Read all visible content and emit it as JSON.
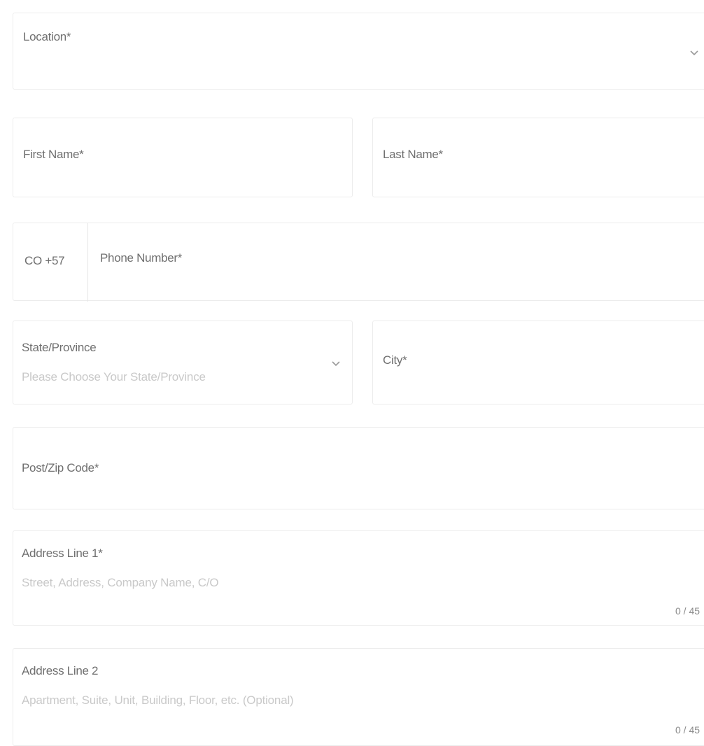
{
  "form": {
    "location": {
      "label": "Location*",
      "icon": "chevron-down-icon"
    },
    "first_name": {
      "label": "First Name*"
    },
    "last_name": {
      "label": "Last Name*"
    },
    "phone": {
      "country_code": "CO +57",
      "label": "Phone Number*"
    },
    "state": {
      "label": "State/Province",
      "placeholder": "Please Choose Your State/Province",
      "icon": "chevron-down-icon"
    },
    "city": {
      "label": "City*"
    },
    "postcode": {
      "label": "Post/Zip Code*"
    },
    "address1": {
      "label": "Address Line 1*",
      "placeholder": "Street, Address, Company Name, C/O",
      "counter": "0 / 45"
    },
    "address2": {
      "label": "Address Line 2",
      "placeholder": "Apartment, Suite, Unit, Building, Floor, etc. (Optional)",
      "counter": "0 / 45"
    }
  },
  "colors": {
    "border": "#ececec",
    "label": "#6f6f6f",
    "placeholder": "#c9c9c9"
  }
}
